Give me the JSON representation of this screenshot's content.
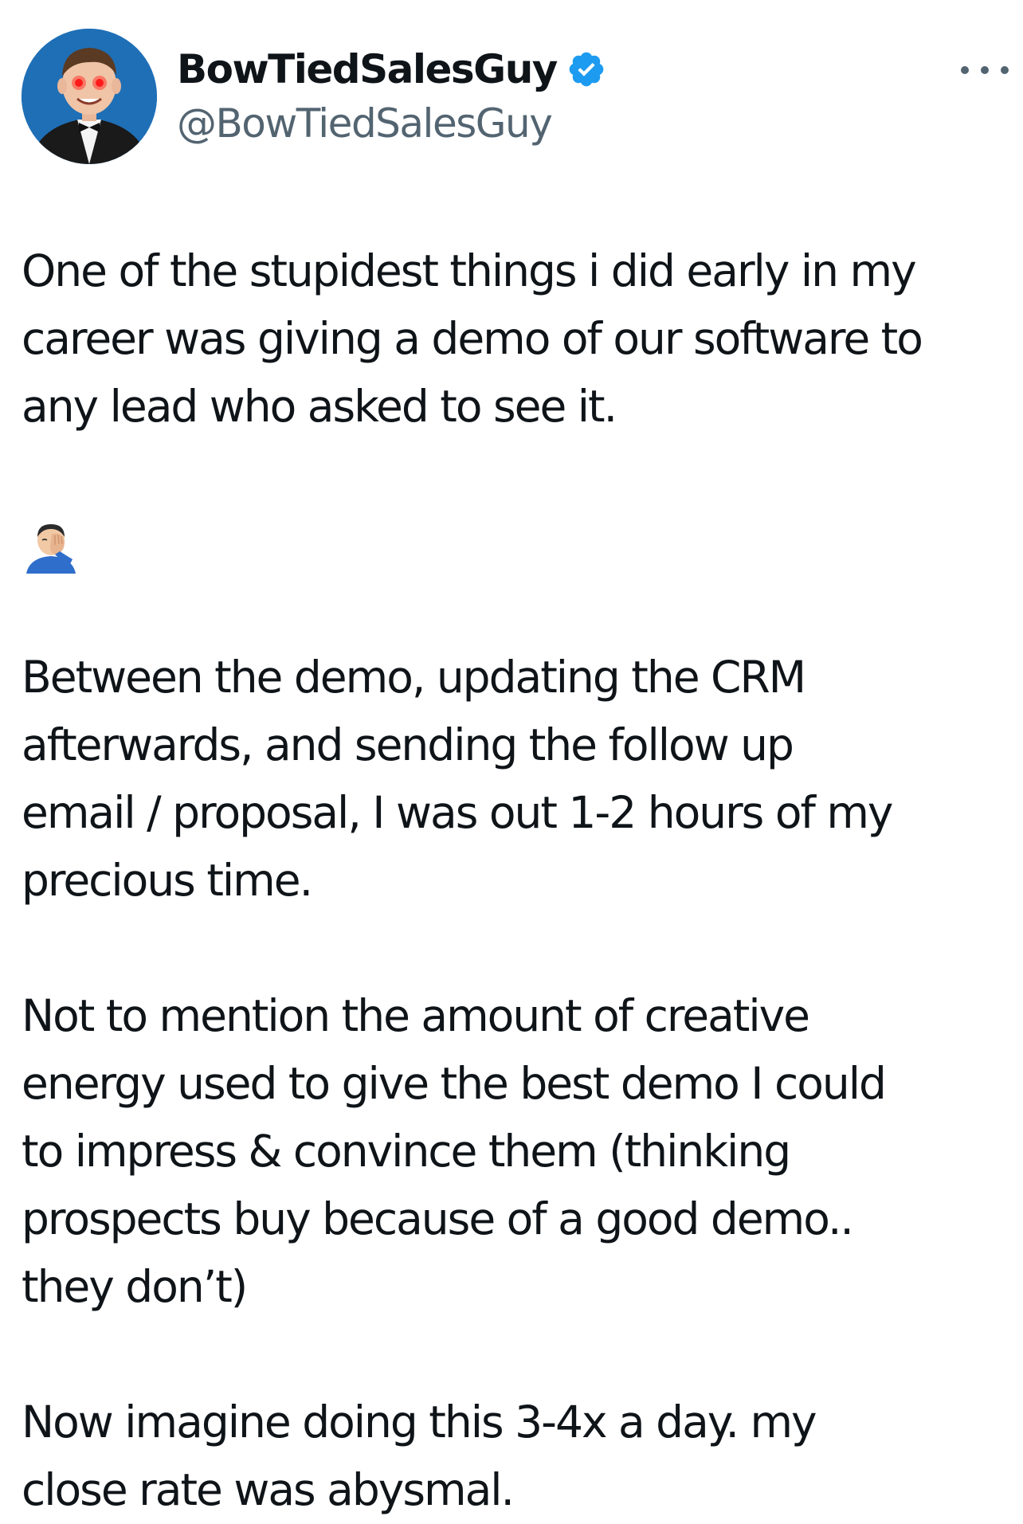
{
  "author": {
    "display_name": "BowTiedSalesGuy",
    "handle": "@BowTiedSalesGuy",
    "verified": true,
    "avatar_icon": "cartoon-man-in-tuxedo-with-glowing-red-eyes-avatar"
  },
  "menu": {
    "more_icon": "more-options-icon"
  },
  "colors": {
    "text": "#0f1419",
    "handle": "#536471",
    "verified_badge": "#1d9bf0",
    "avatar_background": "#1f6fb6"
  },
  "tweet": {
    "paragraph_1": [
      "One of the stupidest things i did early in my",
      "career was giving a demo of our software to",
      "any lead who asked to see it."
    ],
    "emoji": "man-facepalming-emoji",
    "paragraph_2": [
      "Between the demo, updating the CRM",
      "afterwards, and sending the follow up",
      "email / proposal, I was out 1-2 hours of my",
      "precious time."
    ],
    "paragraph_3": [
      "Not to mention the amount of creative",
      "energy used to give the best demo I could",
      "to impress & convince them (thinking",
      "prospects buy because of a good demo..",
      "they don’t)"
    ],
    "paragraph_4": [
      "Now imagine doing this 3-4x a day. my",
      "close rate was abysmal."
    ]
  }
}
